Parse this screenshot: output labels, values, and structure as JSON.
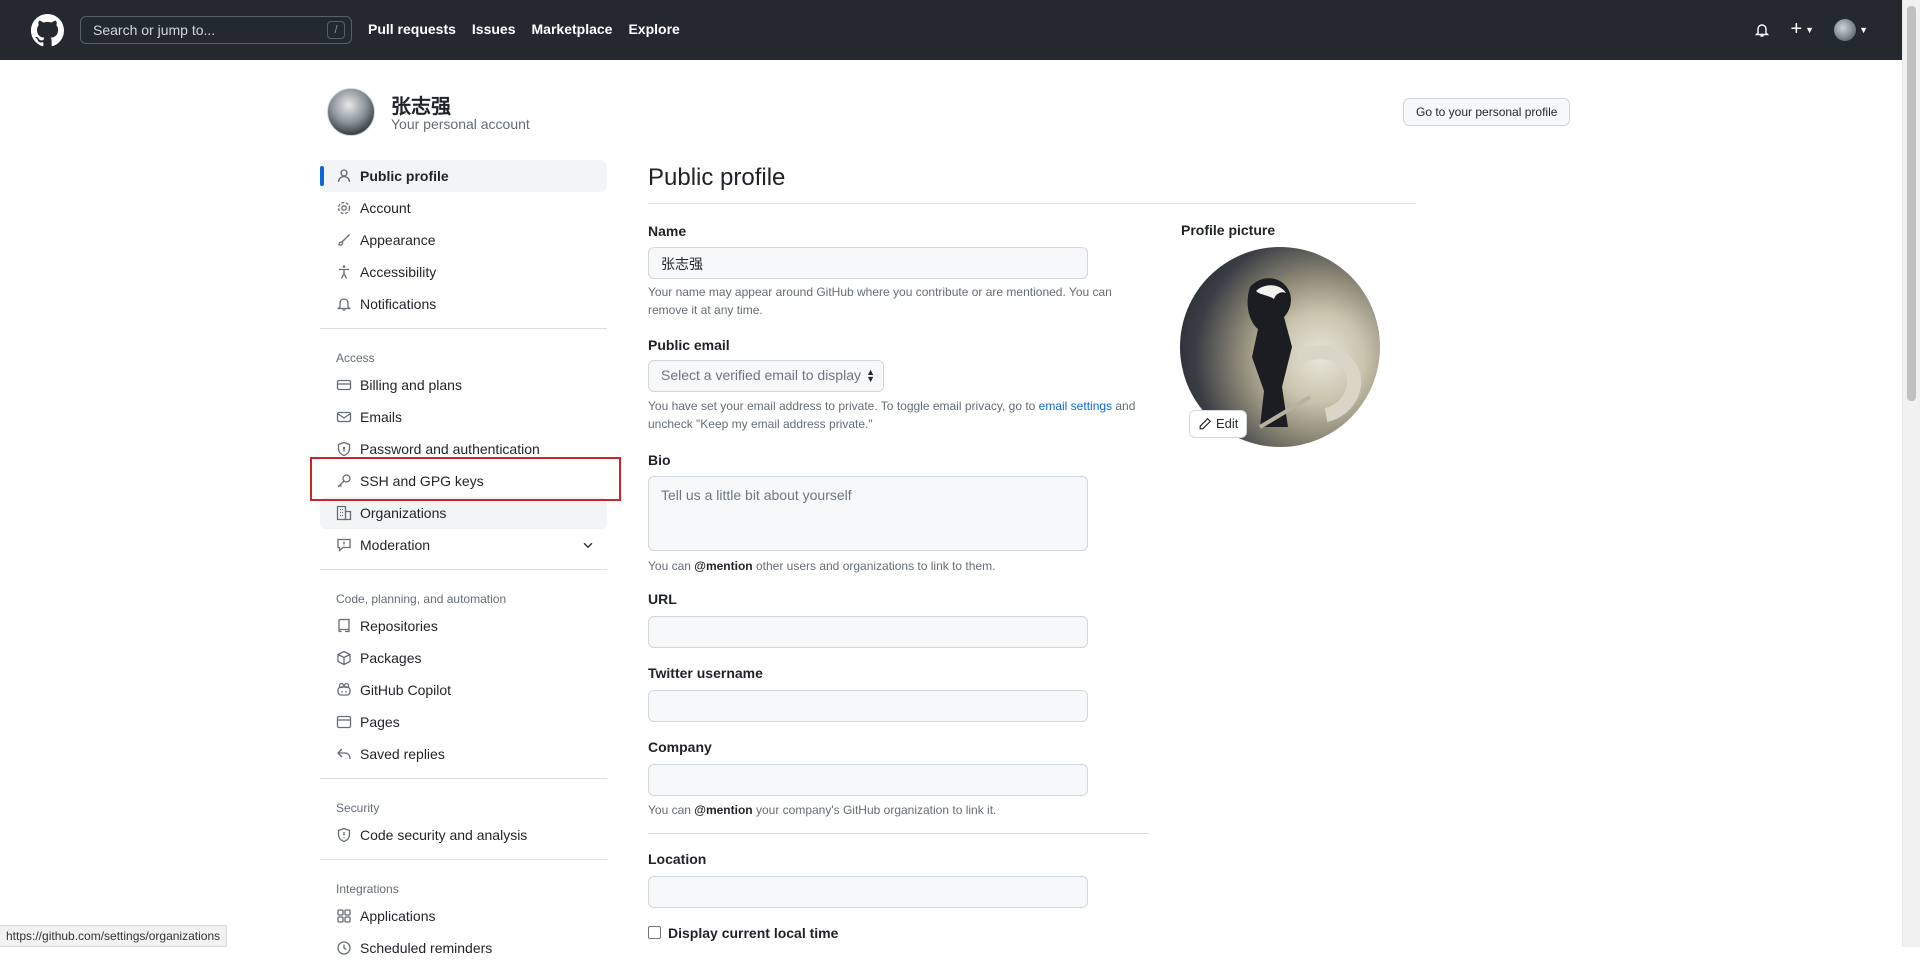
{
  "header": {
    "search_placeholder": "Search or jump to...",
    "search_shortcut": "/",
    "nav": [
      "Pull requests",
      "Issues",
      "Marketplace",
      "Explore"
    ],
    "plus": "+"
  },
  "account": {
    "name": "张志强",
    "subtitle": "Your personal account",
    "goto_button": "Go to your personal profile"
  },
  "sidebar": {
    "top": [
      {
        "label": "Public profile",
        "icon": "person-icon"
      },
      {
        "label": "Account",
        "icon": "gear-icon"
      },
      {
        "label": "Appearance",
        "icon": "paintbrush-icon"
      },
      {
        "label": "Accessibility",
        "icon": "accessibility-icon"
      },
      {
        "label": "Notifications",
        "icon": "bell-icon"
      }
    ],
    "access_heading": "Access",
    "access": [
      {
        "label": "Billing and plans",
        "icon": "credit-card-icon"
      },
      {
        "label": "Emails",
        "icon": "mail-icon"
      },
      {
        "label": "Password and authentication",
        "icon": "shield-lock-icon"
      },
      {
        "label": "SSH and GPG keys",
        "icon": "key-icon"
      },
      {
        "label": "Organizations",
        "icon": "organization-icon"
      },
      {
        "label": "Moderation",
        "icon": "report-icon"
      }
    ],
    "code_heading": "Code, planning, and automation",
    "code": [
      {
        "label": "Repositories",
        "icon": "repo-icon"
      },
      {
        "label": "Packages",
        "icon": "package-icon"
      },
      {
        "label": "GitHub Copilot",
        "icon": "copilot-icon"
      },
      {
        "label": "Pages",
        "icon": "browser-icon"
      },
      {
        "label": "Saved replies",
        "icon": "reply-icon"
      }
    ],
    "security_heading": "Security",
    "security": [
      {
        "label": "Code security and analysis",
        "icon": "shield-icon"
      }
    ],
    "integrations_heading": "Integrations",
    "integrations": [
      {
        "label": "Applications",
        "icon": "apps-icon"
      },
      {
        "label": "Scheduled reminders",
        "icon": "clock-icon"
      }
    ]
  },
  "main": {
    "title": "Public profile",
    "name_label": "Name",
    "name_value": "张志强",
    "name_note": "Your name may appear around GitHub where you contribute or are mentioned. You can remove it at any time.",
    "email_label": "Public email",
    "email_select": "Select a verified email to display",
    "email_note_1": "You have set your email address to private. To toggle email privacy, go to ",
    "email_note_link": "email settings",
    "email_note_2": " and uncheck \"Keep my email address private.\"",
    "bio_label": "Bio",
    "bio_placeholder": "Tell us a little bit about yourself",
    "bio_note_1": "You can ",
    "bio_note_mention": "@mention",
    "bio_note_2": " other users and organizations to link to them.",
    "url_label": "URL",
    "twitter_label": "Twitter username",
    "company_label": "Company",
    "company_note_1": "You can ",
    "company_note_mention": "@mention",
    "company_note_2": " your company's GitHub organization to link it.",
    "location_label": "Location",
    "local_time_label": "Display current local time"
  },
  "profile_picture": {
    "label": "Profile picture",
    "edit": "Edit"
  },
  "statusbar": {
    "url": "https://github.com/settings/organizations"
  },
  "colors": {
    "header_bg": "#24292f",
    "accent": "#0969da",
    "highlight_box": "#c9262b"
  }
}
